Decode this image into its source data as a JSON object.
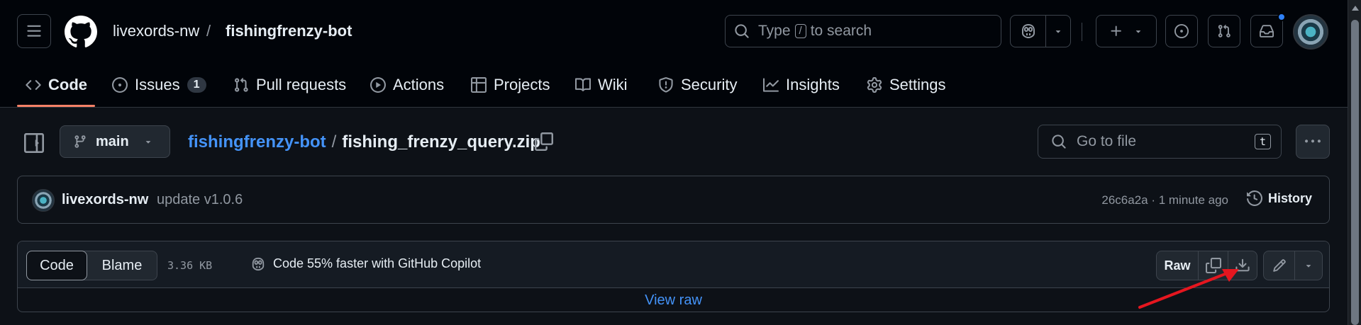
{
  "header": {
    "owner": "livexords-nw",
    "separator": "/",
    "repo": "fishingfrenzy-bot",
    "search": {
      "prefix": "Type",
      "key": "/",
      "suffix": "to search"
    }
  },
  "tabs": [
    {
      "label": "Code",
      "icon": "code-icon",
      "active": true
    },
    {
      "label": "Issues",
      "icon": "issue-opened-icon",
      "count": "1"
    },
    {
      "label": "Pull requests",
      "icon": "git-pull-request-icon"
    },
    {
      "label": "Actions",
      "icon": "play-icon"
    },
    {
      "label": "Projects",
      "icon": "table-icon"
    },
    {
      "label": "Wiki",
      "icon": "book-icon"
    },
    {
      "label": "Security",
      "icon": "shield-icon"
    },
    {
      "label": "Insights",
      "icon": "graph-icon"
    },
    {
      "label": "Settings",
      "icon": "gear-icon"
    }
  ],
  "file_nav": {
    "branch": "main",
    "repo_link": "fishingfrenzy-bot",
    "separator": "/",
    "file_name": "fishing_frenzy_query.zip",
    "goto_placeholder": "Go to file",
    "goto_shortcut": "t"
  },
  "commit": {
    "author": "livexords-nw",
    "message": "update v1.0.6",
    "meta": "26c6a2a · 1 minute ago",
    "history_label": "History"
  },
  "viewer": {
    "code_label": "Code",
    "blame_label": "Blame",
    "file_size": "3.36 KB",
    "copilot_promo": "Code 55% faster with GitHub Copilot",
    "raw_label": "Raw",
    "view_raw_label": "View raw"
  },
  "colors": {
    "accent_link": "#4493f8",
    "tab_underline": "#f78166",
    "annotation_arrow": "#e5161f",
    "notification_dot": "#2f81f7"
  }
}
